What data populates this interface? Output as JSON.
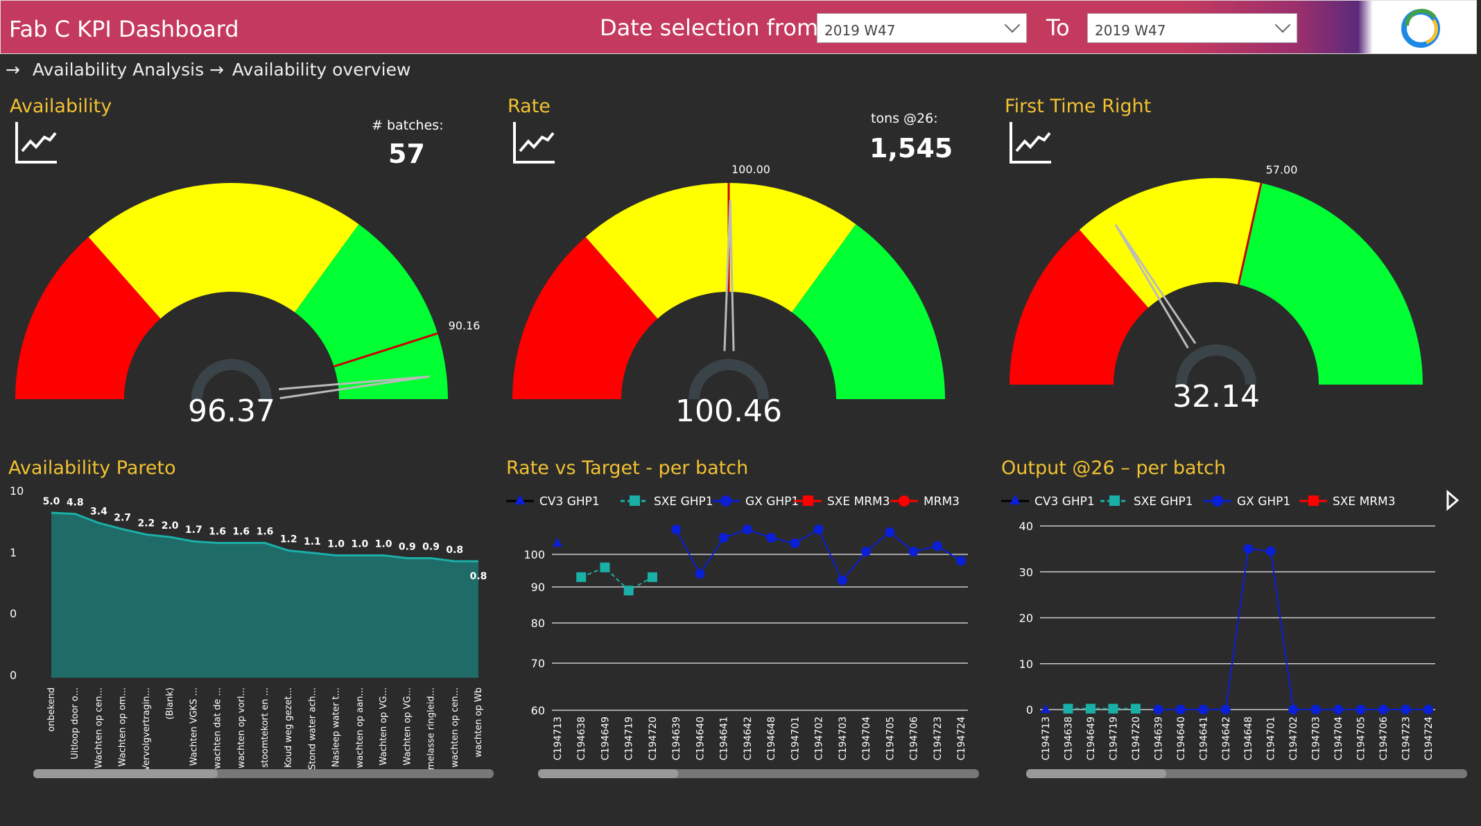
{
  "header": {
    "title": "Fab C KPI Dashboard",
    "date_from_label": "Date selection from",
    "date_from_value": "2019 W47",
    "to_label": "To",
    "date_to_value": "2019 W47",
    "logo_icon": "swirl-logo-icon"
  },
  "nav": [
    {
      "label": "Availability Analysis",
      "icon": "arrow-right-icon"
    },
    {
      "label": "Availability overview",
      "icon": "arrow-right-icon"
    }
  ],
  "gauges": [
    {
      "title": "Availability",
      "stat_label": "# batches:",
      "stat_value": "57",
      "target_label": "90.16",
      "value_label": "96.37",
      "value": 96.37,
      "target": 90.16
    },
    {
      "title": "Rate",
      "stat_label": "tons @26:",
      "stat_value": "1,545",
      "target_label": "100.00",
      "value_label": "100.46",
      "value": 100.46,
      "target": 100.0
    },
    {
      "title": "First Time Right",
      "stat_label": "",
      "stat_value": "",
      "target_label": "57.00",
      "value_label": "32.14",
      "value": 32.14,
      "target": 57.0
    }
  ],
  "colors": {
    "red": "#ff0000",
    "yellow": "#ffff00",
    "green": "#00ff33",
    "title": "#f1c232",
    "area": "#1f6b68",
    "area_line": "#1ab0a8",
    "series_blue": "#0b1fd6",
    "series_teal": "#1ab0a8",
    "series_red": "#ff0000"
  },
  "charts": {
    "pareto": {
      "title": "Availability Pareto",
      "y_ticks": [
        "10",
        "1",
        "0",
        "0"
      ],
      "categories": [
        "onbekend",
        "Uitloop door o...",
        "Wachten op cen...",
        "Wachten op om...",
        "Vervolgvertragin...",
        "(Blank)",
        "Wachten VGKS ...",
        "wachten dat de ...",
        "wachten op vorl...",
        "stoomtekort en ...",
        "Koud weg gezet...",
        "Stond water ach...",
        "Nasleep water t...",
        "wachten op aan...",
        "Wachten op VG...",
        "Wachten op VG...",
        "melasse ringleid...",
        "wachten op cen...",
        "wachten op Wb"
      ],
      "value_labels": [
        "5.0",
        "4.8",
        "3.4",
        "2.7",
        "2.2",
        "2.0",
        "1.7",
        "1.6",
        "1.6",
        "1.6",
        "1.2",
        "1.1",
        "1.0",
        "1.0",
        "1.0",
        "0.9",
        "0.9",
        "0.8",
        "0.8"
      ]
    },
    "rate": {
      "title": "Rate vs Target - per batch",
      "legend": [
        "CV3 GHP1",
        "SXE GHP1",
        "GX GHP1",
        "SXE MRM3",
        "MRM3"
      ],
      "y_ticks": [
        "100",
        "90",
        "80",
        "70",
        "60"
      ],
      "categories": [
        "C194713",
        "C194638",
        "C194649",
        "C194719",
        "C194720",
        "C194639",
        "C194640",
        "C194641",
        "C194642",
        "C194648",
        "C194701",
        "C194702",
        "C194703",
        "C194704",
        "C194705",
        "C194706",
        "C194723",
        "C194724"
      ]
    },
    "output": {
      "title": "Output @26 – per batch",
      "legend": [
        "CV3 GHP1",
        "SXE GHP1",
        "GX GHP1",
        "SXE MRM3"
      ],
      "y_ticks": [
        "40",
        "30",
        "20",
        "10",
        "0"
      ],
      "categories": [
        "C194713",
        "C194638",
        "C194649",
        "C194719",
        "C194720",
        "C194639",
        "C194640",
        "C194641",
        "C194642",
        "C194648",
        "C194701",
        "C194702",
        "C194703",
        "C194704",
        "C194705",
        "C194706",
        "C194723",
        "C194724"
      ]
    }
  },
  "chart_data": [
    {
      "type": "area",
      "title": "Availability Pareto",
      "categories": [
        "onbekend",
        "Uitloop door o...",
        "Wachten op cen...",
        "Wachten op om...",
        "Vervolgvertragin...",
        "(Blank)",
        "Wachten VGKS ...",
        "wachten dat de ...",
        "wachten op vorl...",
        "stoomtekort en ...",
        "Koud weg gezet...",
        "Stond water ach...",
        "Nasleep water t...",
        "wachten op aan...",
        "Wachten op VG...",
        "Wachten op VG...",
        "melasse ringleid...",
        "wachten op cen...",
        "wachten op Wb"
      ],
      "values": [
        5.0,
        4.8,
        3.4,
        2.7,
        2.2,
        2.0,
        1.7,
        1.6,
        1.6,
        1.6,
        1.2,
        1.1,
        1.0,
        1.0,
        1.0,
        0.9,
        0.9,
        0.8,
        0.8
      ],
      "yscale": "log"
    },
    {
      "type": "line",
      "title": "Rate vs Target - per batch",
      "categories": [
        "C194713",
        "C194638",
        "C194649",
        "C194719",
        "C194720",
        "C194639",
        "C194640",
        "C194641",
        "C194642",
        "C194648",
        "C194701",
        "C194702",
        "C194703",
        "C194704",
        "C194705",
        "C194706",
        "C194723",
        "C194724"
      ],
      "series": [
        {
          "name": "CV3 GHP1",
          "values": [
            104,
            null,
            null,
            null,
            null,
            null,
            null,
            null,
            null,
            null,
            null,
            null,
            null,
            null,
            null,
            null,
            null,
            null
          ]
        },
        {
          "name": "SXE GHP1",
          "values": [
            null,
            93,
            96,
            89,
            93,
            null,
            null,
            null,
            null,
            null,
            null,
            null,
            null,
            null,
            null,
            null,
            null,
            null
          ]
        },
        {
          "name": "GX GHP1",
          "values": [
            null,
            null,
            null,
            null,
            null,
            109,
            94,
            106,
            109,
            106,
            104,
            109,
            92,
            101,
            108,
            101,
            103,
            98
          ]
        }
      ],
      "ylim": [
        60,
        110
      ]
    },
    {
      "type": "line",
      "title": "Output @26 – per batch",
      "categories": [
        "C194713",
        "C194638",
        "C194649",
        "C194719",
        "C194720",
        "C194639",
        "C194640",
        "C194641",
        "C194642",
        "C194648",
        "C194701",
        "C194702",
        "C194703",
        "C194704",
        "C194705",
        "C194706",
        "C194723",
        "C194724"
      ],
      "series": [
        {
          "name": "CV3 GHP1",
          "values": [
            0,
            null,
            null,
            null,
            null,
            null,
            null,
            null,
            null,
            null,
            null,
            null,
            null,
            null,
            null,
            null,
            null,
            null
          ]
        },
        {
          "name": "SXE GHP1",
          "values": [
            null,
            0.2,
            0.2,
            0.2,
            0.2,
            null,
            null,
            null,
            null,
            null,
            null,
            null,
            null,
            null,
            null,
            null,
            null,
            null
          ]
        },
        {
          "name": "GX GHP1",
          "values": [
            null,
            null,
            null,
            null,
            null,
            0,
            0,
            0,
            0,
            35,
            34.5,
            0,
            0,
            0,
            0,
            0,
            0,
            0
          ]
        }
      ],
      "ylim": [
        0,
        40
      ]
    }
  ]
}
